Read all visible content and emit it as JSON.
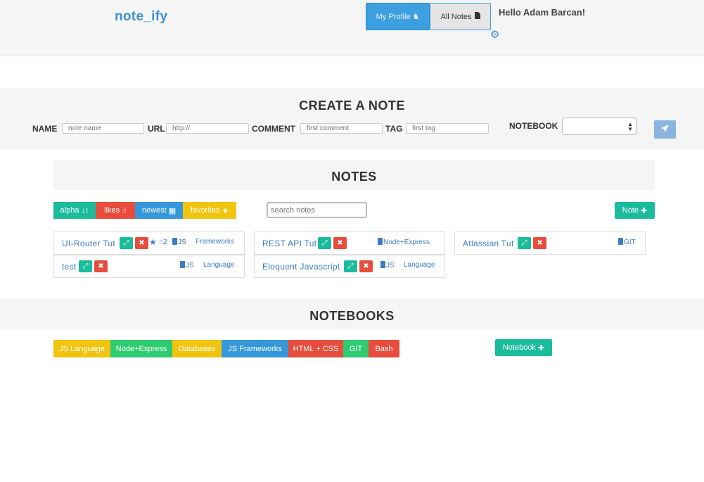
{
  "header": {
    "brand": "note_ify",
    "my_profile": "My Profile",
    "all_notes": "All Notes",
    "greeting": "Hello Adam Barcan!"
  },
  "create": {
    "title": "CREATE A NOTE",
    "name_label": "NAME",
    "name_placeholder": "note name",
    "url_label": "URL",
    "url_placeholder": "http://",
    "comment_label": "COMMENT",
    "comment_placeholder": "first comment",
    "tag_label": "TAG",
    "tag_placeholder": "first tag",
    "notebook_label": "NOTEBOOK",
    "notebook_selected": ""
  },
  "notes": {
    "title": "NOTES",
    "sort": {
      "alpha": "alpha",
      "likes": "likes",
      "newest": "newest",
      "favorites": "favorites"
    },
    "search_placeholder": "search notes",
    "add_note": "Note",
    "cards": [
      {
        "title": "UI-Router Tut",
        "likes": "2",
        "tags": [
          "JS",
          "Frameworks"
        ]
      },
      {
        "title": "REST API Tut",
        "tags": [
          "Node+Express"
        ]
      },
      {
        "title": "Atlassian Tut",
        "tags": [
          "GIT"
        ]
      },
      {
        "title": "test",
        "tags": [
          "JS",
          "Language"
        ]
      },
      {
        "title": "Eloquent Javascript",
        "tags": [
          "JS",
          "Language"
        ]
      }
    ]
  },
  "notebooks": {
    "title": "NOTEBOOKS",
    "items": [
      {
        "label": "JS Language",
        "color": "#f1c40f"
      },
      {
        "label": "Node+Express",
        "color": "#2ecc71"
      },
      {
        "label": "Databases",
        "color": "#f1c40f"
      },
      {
        "label": "JS Frameworks",
        "color": "#3498db"
      },
      {
        "label": "HTML + CSS",
        "color": "#e74c3c"
      },
      {
        "label": "GIT",
        "color": "#2ecc71"
      },
      {
        "label": "Bash",
        "color": "#e74c3c"
      }
    ],
    "add_notebook": "Notebook"
  },
  "colors": {
    "accent": "#3d8fd6",
    "teal": "#1bbc9b",
    "red": "#e74c3c",
    "blue": "#3498db",
    "yellow": "#f1c40f",
    "green": "#2ecc71"
  }
}
